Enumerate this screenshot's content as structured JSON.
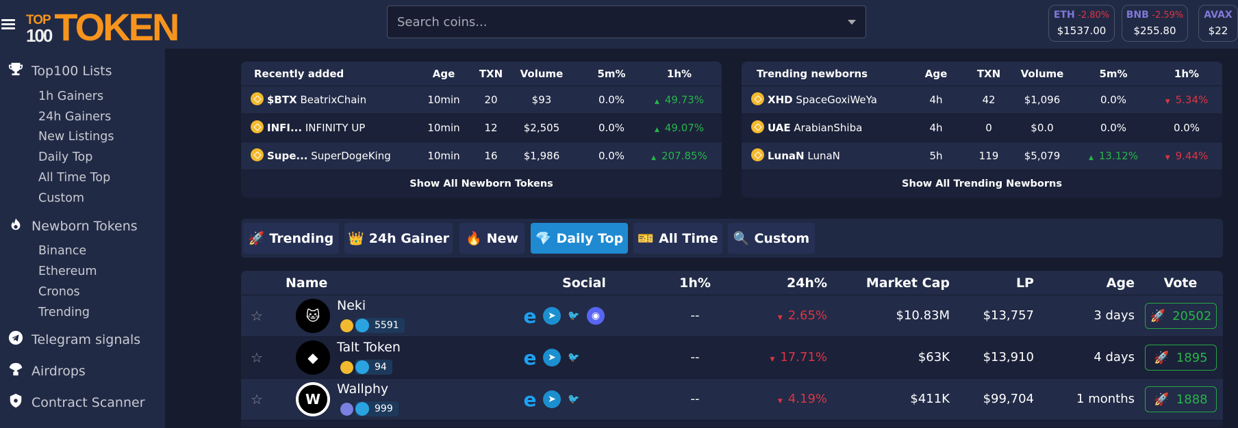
{
  "header": {
    "logo_small_top": "TOP",
    "logo_small_bottom": "100",
    "logo_big": "TOKEN",
    "search_placeholder": "Search coins..."
  },
  "prices": [
    {
      "symbol": "ETH",
      "change": "-2.80%",
      "price": "$1537.00"
    },
    {
      "symbol": "BNB",
      "change": "-2.59%",
      "price": "$255.80"
    },
    {
      "symbol": "AVAX",
      "change": "",
      "price": "$22"
    }
  ],
  "sidebar": {
    "top100": {
      "label": "Top100 Lists",
      "items": [
        "1h Gainers",
        "24h Gainers",
        "New Listings",
        "Daily Top",
        "All Time Top",
        "Custom"
      ]
    },
    "newborn": {
      "label": "Newborn Tokens",
      "items": [
        "Binance",
        "Ethereum",
        "Cronos",
        "Trending"
      ]
    },
    "telegram": "Telegram signals",
    "airdrops": "Airdrops",
    "scanner": "Contract Scanner"
  },
  "recent": {
    "headers": [
      "Recently added",
      "Age",
      "TXN",
      "Volume",
      "5m%",
      "1h%"
    ],
    "rows": [
      {
        "sym": "$BTX",
        "name": "BeatrixChain",
        "age": "10min",
        "txn": "20",
        "vol": "$93",
        "m5": "0.0%",
        "h1": "49.73%",
        "h1dir": "up"
      },
      {
        "sym": "INFI...",
        "name": "INFINITY UP",
        "age": "10min",
        "txn": "12",
        "vol": "$2,505",
        "m5": "0.0%",
        "h1": "49.07%",
        "h1dir": "up"
      },
      {
        "sym": "Supe...",
        "name": "SuperDogeKing",
        "age": "10min",
        "txn": "16",
        "vol": "$1,986",
        "m5": "0.0%",
        "h1": "207.85%",
        "h1dir": "up"
      }
    ],
    "footer": "Show All Newborn Tokens"
  },
  "trending": {
    "headers": [
      "Trending newborns",
      "Age",
      "TXN",
      "Volume",
      "5m%",
      "1h%"
    ],
    "rows": [
      {
        "sym": "XHD",
        "name": "SpaceGoxiWeYa",
        "age": "4h",
        "txn": "42",
        "vol": "$1,096",
        "m5": "0.0%",
        "h1": "5.34%",
        "h1dir": "dn"
      },
      {
        "sym": "UAE",
        "name": "ArabianShiba",
        "age": "4h",
        "txn": "0",
        "vol": "$0.0",
        "m5": "0.0%",
        "h1": "0.0%",
        "h1dir": ""
      },
      {
        "sym": "LunaN",
        "name": "LunaN",
        "age": "5h",
        "txn": "119",
        "vol": "$5,079",
        "m5": "13.12%",
        "m5dir": "up",
        "h1": "9.44%",
        "h1dir": "dn"
      }
    ],
    "footer": "Show All Trending Newborns"
  },
  "tabs": [
    {
      "icon": "🚀",
      "label": "Trending"
    },
    {
      "icon": "👑",
      "label": "24h Gainer"
    },
    {
      "icon": "🔥",
      "label": "New"
    },
    {
      "icon": "💎",
      "label": "Daily Top",
      "active": true
    },
    {
      "icon": "🎫",
      "label": "All Time"
    },
    {
      "icon": "🔍",
      "label": "Custom"
    }
  ],
  "table": {
    "headers": [
      "Name",
      "Social",
      "1h%",
      "24h%",
      "Market Cap",
      "LP",
      "Age",
      "Vote"
    ],
    "rows": [
      {
        "name": "Neki",
        "chain": "bsc",
        "tg": "5591",
        "socials": [
          "website",
          "telegram",
          "twitter",
          "discord"
        ],
        "h1": "--",
        "h24": "2.65%",
        "mcap": "$10.83M",
        "lp": "$13,757",
        "age": "3 days",
        "votes": "20502"
      },
      {
        "name": "Talt Token",
        "chain": "bsc",
        "tg": "94",
        "socials": [
          "website",
          "telegram",
          "twitter"
        ],
        "h1": "--",
        "h24": "17.71%",
        "mcap": "$63K",
        "lp": "$13,910",
        "age": "4 days",
        "votes": "1895"
      },
      {
        "name": "Wallphy",
        "chain": "eth",
        "tg": "999",
        "socials": [
          "website",
          "telegram",
          "twitter"
        ],
        "h1": "--",
        "h24": "4.19%",
        "mcap": "$411K",
        "lp": "$99,704",
        "age": "1 months",
        "votes": "1888"
      }
    ]
  },
  "colors": {
    "accent": "#1f8ad1",
    "logo": "#f7941d",
    "up": "#28b54a",
    "down": "#dc3545"
  }
}
